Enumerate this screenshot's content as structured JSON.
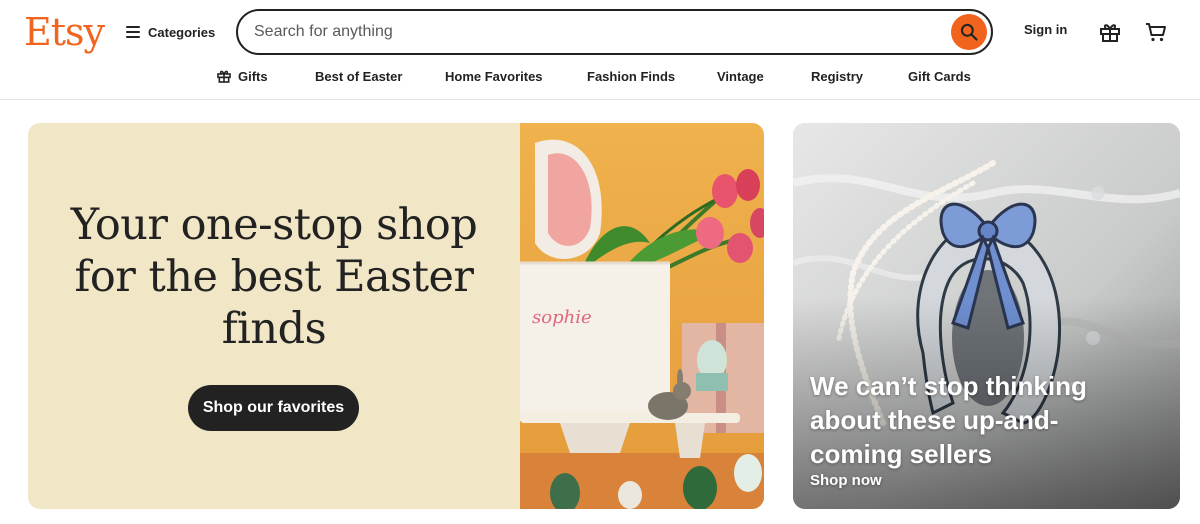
{
  "brand": {
    "logo": "Etsy",
    "accent": "#f1641e"
  },
  "header": {
    "categories_label": "Categories",
    "search_placeholder": "Search for anything",
    "search_value": "",
    "signin_label": "Sign in",
    "icons": {
      "search": "search-icon",
      "gift": "gift-icon",
      "cart": "cart-icon",
      "menu": "hamburger-icon"
    }
  },
  "nav": {
    "items": [
      {
        "label": "Gifts",
        "icon": "gift-icon"
      },
      {
        "label": "Best of Easter"
      },
      {
        "label": "Home Favorites"
      },
      {
        "label": "Fashion Finds"
      },
      {
        "label": "Vintage"
      },
      {
        "label": "Registry"
      },
      {
        "label": "Gift Cards"
      }
    ]
  },
  "hero": {
    "title": "Your one-stop shop for the best Easter finds",
    "cta_label": "Shop our favorites",
    "image_caption": "sophie",
    "background": "#f1e6c5"
  },
  "promo": {
    "title": "We can’t stop thinking about these up-and-coming sellers",
    "link_label": "Shop now"
  }
}
